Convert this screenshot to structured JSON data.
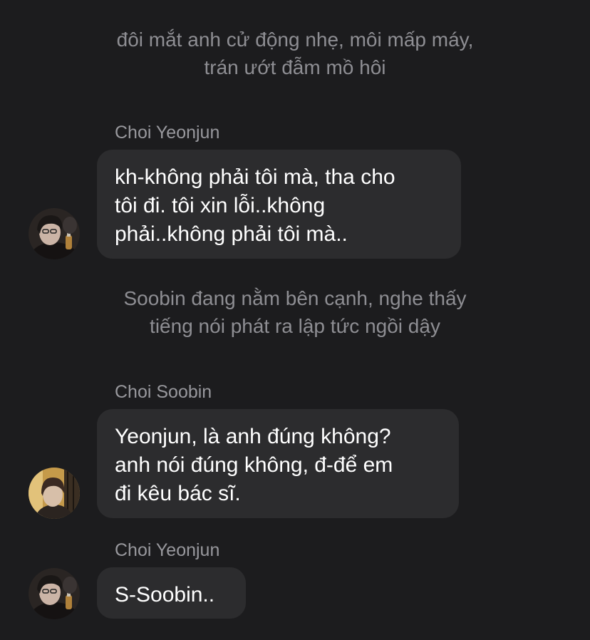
{
  "chat": {
    "narration_1": "đôi mắt anh cử động nhẹ, môi mấp máy,\ntrán ướt đẫm mồ hôi",
    "message_1": {
      "sender": "Choi Yeonjun",
      "text": "kh-không phải tôi mà, tha cho\ntôi đi. tôi xin lỗi..không\nphải..không phải tôi mà.."
    },
    "narration_2": "Soobin đang nằm bên cạnh, nghe thấy\ntiếng nói phát ra lập tức ngồi dậy",
    "message_2": {
      "sender": "Choi Soobin",
      "text": "Yeonjun, là anh đúng không?\nanh nói đúng không, đ-để em\nđi kêu bác sĩ."
    },
    "message_3": {
      "sender": "Choi Yeonjun",
      "text": "S-Soobin.."
    }
  },
  "colors": {
    "background": "#1c1c1e",
    "bubble": "#2c2c2e",
    "narration_text": "#8e8e93",
    "sender_name": "#98989d",
    "message_text": "#ffffff"
  },
  "icons": {
    "avatar_yeonjun": "avatar-photo-yeonjun",
    "avatar_soobin": "avatar-photo-soobin"
  }
}
